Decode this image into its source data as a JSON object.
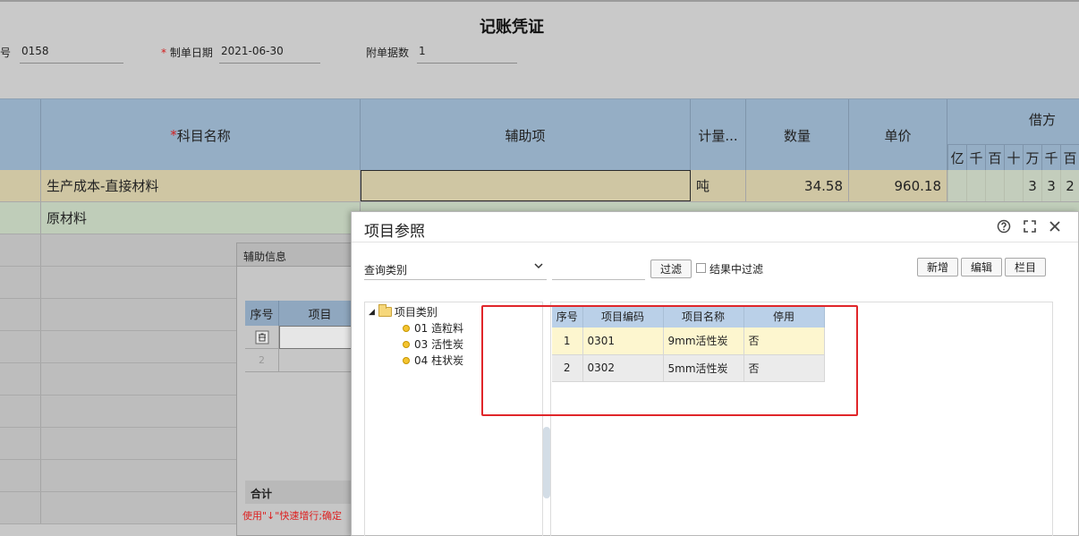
{
  "voucher": {
    "title": "记账凭证",
    "number_label": "编号",
    "number_value": "0158",
    "date_label": "制单日期",
    "date_value": "2021-06-30",
    "attachments_label": "附单据数",
    "attachments_value": "1",
    "required_mark": "*"
  },
  "table_header": {
    "subject": "科目名称",
    "auxiliary": "辅助项",
    "unit": "计量...",
    "quantity": "数量",
    "price": "单价",
    "debit": "借方",
    "digits": [
      "亿",
      "千",
      "百",
      "十",
      "万",
      "千",
      "百"
    ]
  },
  "rows": [
    {
      "subject": "生产成本-直接材料",
      "auxiliary": "",
      "unit": "吨",
      "quantity": "34.58",
      "price": "960.18",
      "debit_digits": [
        "3",
        "3",
        "2"
      ]
    },
    {
      "subject": "原材料"
    }
  ],
  "aux_panel": {
    "title": "辅助信息",
    "col_index": "序号",
    "col_item": "项目",
    "row1_icon": "delete-row-icon",
    "row2_index": "2",
    "total_label": "合计",
    "hint": "使用\"↓\"快速增行;确定"
  },
  "dialog": {
    "title": "项目参照",
    "query_select": "查询类别",
    "filter_button": "过滤",
    "filter_in_results": "结果中过滤",
    "new_button": "新增",
    "edit_button": "编辑",
    "columns_button": "栏目",
    "icons": {
      "help": "help-icon",
      "maximize": "maximize-icon",
      "close": "close-icon"
    },
    "tree": {
      "root": "项目类别",
      "children": [
        "01 造粒料",
        "03 活性炭",
        "04 柱状炭"
      ]
    },
    "grid": {
      "headers": [
        "序号",
        "项目编码",
        "项目名称",
        "停用"
      ],
      "rows": [
        [
          "1",
          "0301",
          "9mm活性炭",
          "否"
        ],
        [
          "2",
          "0302",
          "5mm活性炭",
          "否"
        ]
      ]
    }
  },
  "colors": {
    "header_blue": "#95aec5",
    "row_selected": "#cfc6a3",
    "row_second": "#bfcdb9",
    "highlight_red": "#e0262a",
    "grid_header": "#bad0e8"
  }
}
